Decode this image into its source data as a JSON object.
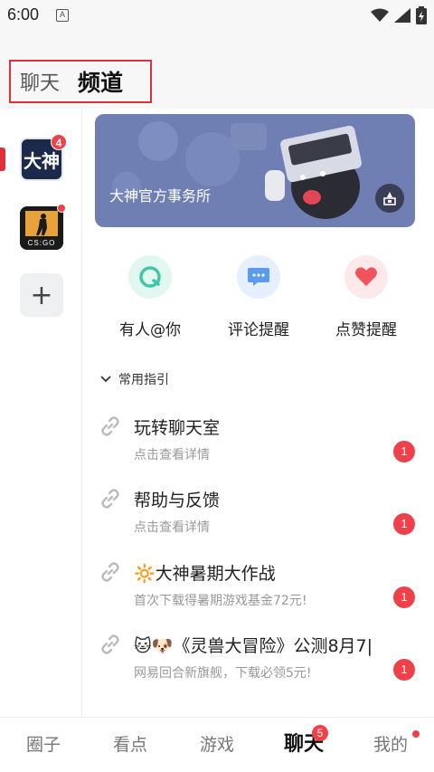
{
  "status_bar": {
    "time": "6:00",
    "notification_icon": "A"
  },
  "header": {
    "tabs": [
      {
        "label": "聊天"
      },
      {
        "label": "频道"
      }
    ]
  },
  "sidebar": {
    "channels": [
      {
        "name": "大神",
        "badge": "4"
      },
      {
        "name": "CS:GO",
        "badge_dot": true
      }
    ],
    "add_icon": "+"
  },
  "banner": {
    "title": "大神官方事务所"
  },
  "quick_actions": [
    {
      "label": "有人@你",
      "icon": "at-icon",
      "color": "#3fc7a6"
    },
    {
      "label": "评论提醒",
      "icon": "comment-icon",
      "color": "#5a9bf0"
    },
    {
      "label": "点赞提醒",
      "icon": "heart-icon",
      "color": "#f0535c"
    }
  ],
  "guide_section": {
    "title": "常用指引",
    "items": [
      {
        "title": "玩转聊天室",
        "subtitle": "点击查看详情",
        "count": "1"
      },
      {
        "title": "帮助与反馈",
        "subtitle": "点击查看详情",
        "count": "1"
      },
      {
        "title": "🔆大神暑期大作战",
        "subtitle": "首次下载得暑期游戏基金72元!",
        "count": "1"
      },
      {
        "title": "🐱🐶《灵兽大冒险》公测8月7|",
        "subtitle": "网易回合新旗舰，下载必领5元!",
        "count": "1"
      }
    ]
  },
  "bottom_nav": {
    "items": [
      {
        "label": "圈子"
      },
      {
        "label": "看点"
      },
      {
        "label": "游戏"
      },
      {
        "label": "聊天",
        "badge": "5"
      },
      {
        "label": "我的"
      }
    ]
  },
  "colors": {
    "accent": "#e0313a",
    "badge": "#f0404a",
    "banner": "#6f7fb3"
  }
}
